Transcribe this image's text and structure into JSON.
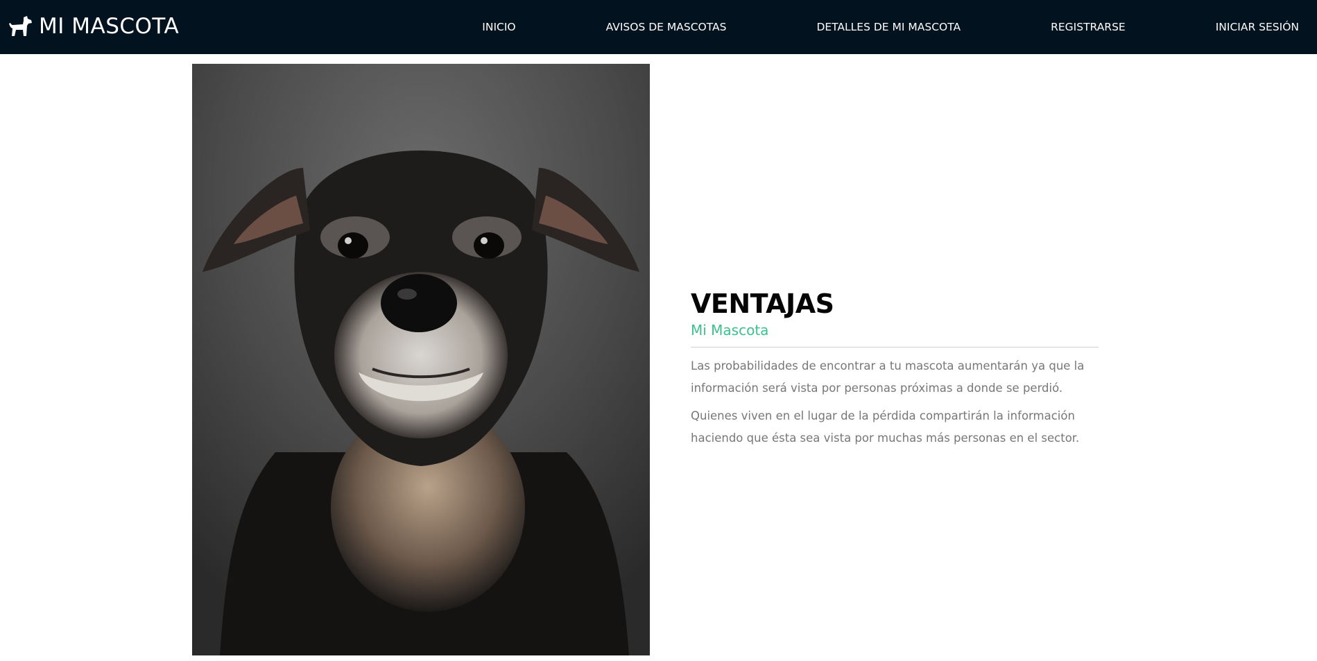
{
  "navbar": {
    "brand": "MI MASCOTA",
    "brand_icon": "dog-icon",
    "background": "#03121f",
    "links": [
      {
        "label": "INICIO"
      },
      {
        "label": "AVISOS DE MASCOTAS"
      },
      {
        "label": "DETALLES DE MI MASCOTA"
      },
      {
        "label": "REGISTRARSE"
      },
      {
        "label": "INICIAR SESIÓN"
      }
    ]
  },
  "hero_image": {
    "subject": "dog-portrait"
  },
  "section": {
    "title": "VENTAJAS",
    "subtitle": "Mi Mascota",
    "accent_color": "#3cc08f",
    "paragraphs": [
      "Las probabilidades de encontrar a tu mascota aumentarán ya que la información será vista por personas próximas a donde se perdió.",
      "Quienes viven en el lugar de la pérdida compartirán la información haciendo que ésta sea vista por muchas más personas en el sector."
    ]
  }
}
